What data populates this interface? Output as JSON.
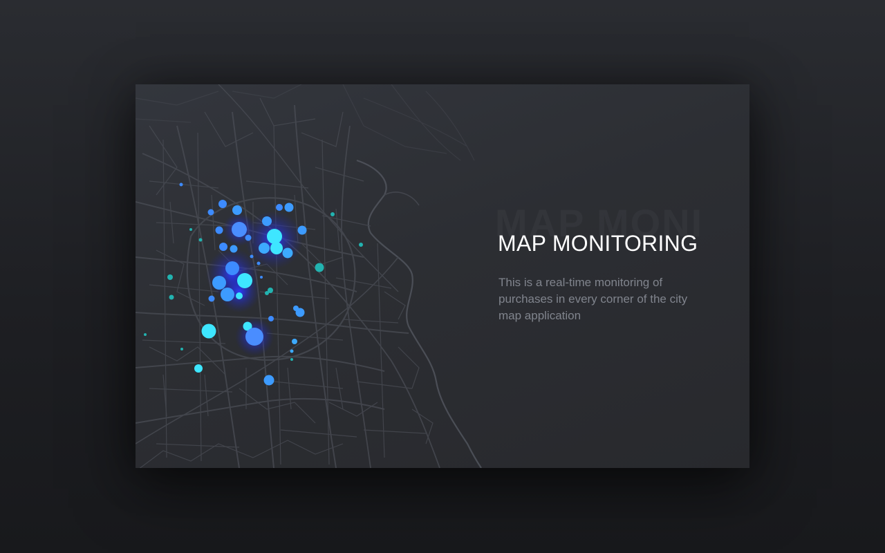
{
  "card": {
    "title": "MAP MONITORING",
    "watermark": "MAP MONI",
    "description_lines": [
      "This is a real-time monitoring of",
      "purchases in every corner of the city",
      "map application"
    ]
  },
  "map": {
    "road_color": "#4a4d55",
    "dot_colors": {
      "primary": "#3d8bff",
      "glow": "#2a36ff",
      "cyan": "#3ee6ff",
      "teal": "#22b3b0"
    }
  }
}
